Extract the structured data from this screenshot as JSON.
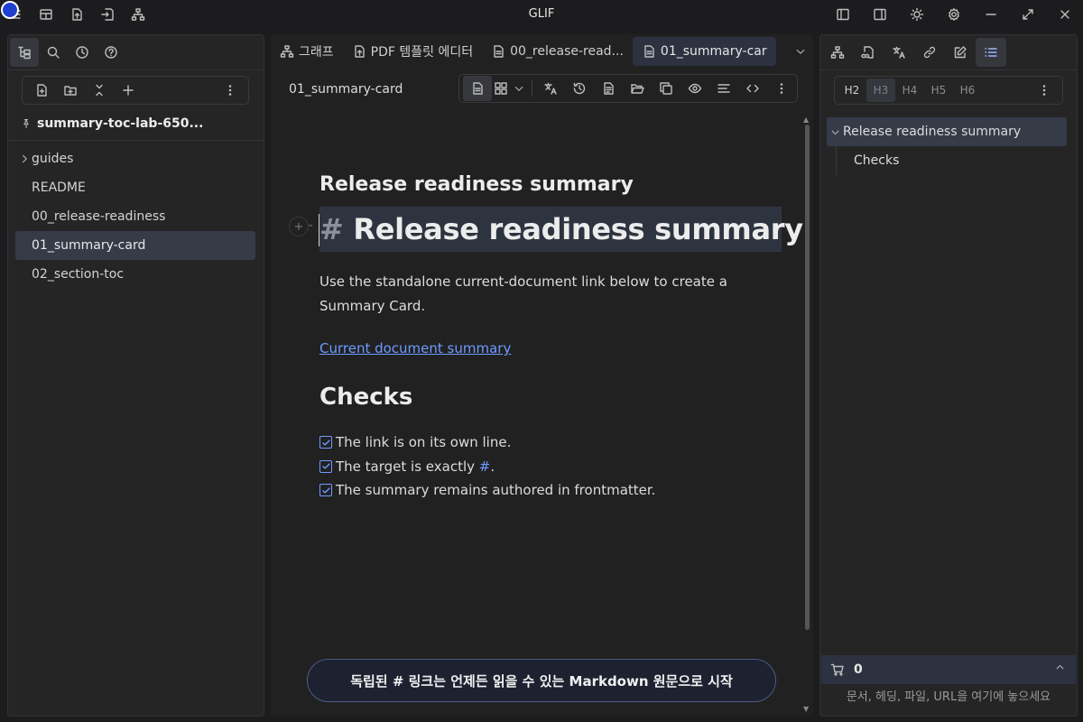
{
  "window": {
    "title": "GLIF"
  },
  "left_panel": {
    "workspace_name": "summary-toc-lab-650...",
    "tree": [
      {
        "label": "guides",
        "type": "folder"
      },
      {
        "label": "README",
        "type": "file"
      },
      {
        "label": "00_release-readiness",
        "type": "file"
      },
      {
        "label": "01_summary-card",
        "type": "file",
        "selected": true
      },
      {
        "label": "02_section-toc",
        "type": "file"
      }
    ]
  },
  "editor": {
    "tabs": [
      {
        "label": "그래프",
        "icon": "graph-icon"
      },
      {
        "label": "PDF 템플릿 에디터",
        "icon": "pdf-file-icon"
      },
      {
        "label": "00_release-read...",
        "icon": "document-icon"
      },
      {
        "label": "01_summary-car",
        "icon": "document-icon",
        "active": true
      }
    ],
    "doc_title": "01_summary-card",
    "content": {
      "subtitle": "Release readiness summary",
      "h1_hash": "#",
      "h1_text": "Release readiness summary",
      "paragraph_line1": "Use the standalone current-document link below to create a",
      "paragraph_line2": "Summary Card.",
      "link_text": "Current document summary",
      "h2": "Checks",
      "checks": [
        {
          "before": "The link is on its own line.",
          "hash": "",
          "after": ""
        },
        {
          "before": "The target is exactly ",
          "hash": "#",
          "after": "."
        },
        {
          "before": "The summary remains authored in frontmatter.",
          "hash": "",
          "after": ""
        }
      ]
    },
    "banner": "독립된 # 링크는 언제든 읽을 수 있는 Markdown 원문으로 시작"
  },
  "right_panel": {
    "heading_levels": [
      "H2",
      "H3",
      "H4",
      "H5",
      "H6"
    ],
    "toc": {
      "main": "Release readiness summary",
      "sub": "Checks"
    },
    "cart_count": "0",
    "drop_hint": "문서, 헤딩, 파일, URL을 여기에 놓으세요"
  },
  "colors": {
    "accent": "#6f9bff",
    "selection": "#363b48",
    "background": "#1c1c1e"
  }
}
